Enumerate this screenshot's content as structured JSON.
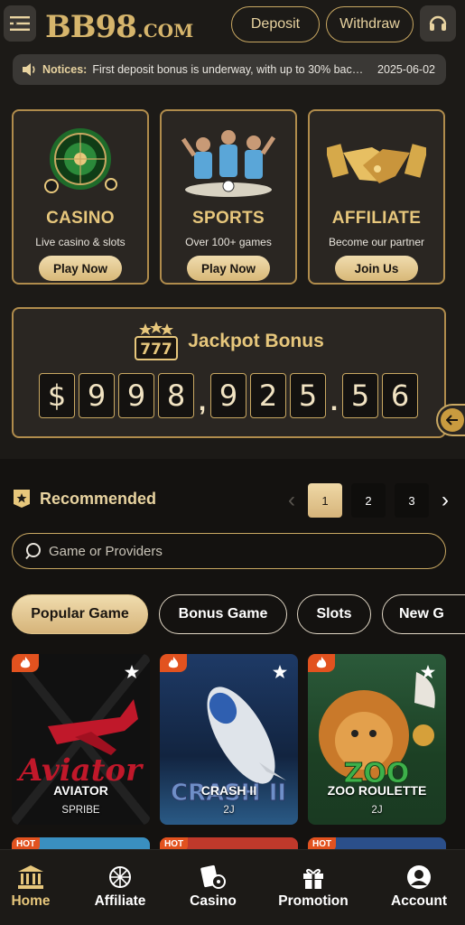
{
  "header": {
    "logo_main": "BB98",
    "logo_suffix": ".COM",
    "deposit_label": "Deposit",
    "withdraw_label": "Withdraw"
  },
  "notice": {
    "label": "Notices:",
    "message": "First deposit bonus is underway, with up to 30% back ...",
    "date": "2025-06-02"
  },
  "categories": [
    {
      "title": "CASINO",
      "subtitle": "Live casino & slots",
      "cta": "Play Now"
    },
    {
      "title": "SPORTS",
      "subtitle": "Over 100+ games",
      "cta": "Play Now"
    },
    {
      "title": "AFFILIATE",
      "subtitle": "Become our partner",
      "cta": "Join Us"
    }
  ],
  "jackpot": {
    "title": "Jackpot Bonus",
    "reel_text": "777",
    "currency": "$",
    "chars": [
      "9",
      "9",
      "8",
      ",",
      "9",
      "2",
      "5",
      ".",
      "5",
      "6"
    ]
  },
  "recommended": {
    "title": "Recommended",
    "pages": [
      "1",
      "2",
      "3"
    ],
    "active_page": "1"
  },
  "search": {
    "placeholder": "Game or Providers"
  },
  "tabs": [
    {
      "label": "Popular Game",
      "active": true
    },
    {
      "label": "Bonus Game",
      "active": false
    },
    {
      "label": "Slots",
      "active": false
    },
    {
      "label": "New G",
      "active": false
    }
  ],
  "games": [
    {
      "name": "AVIATOR",
      "provider": "SPRIBE",
      "art_text": "Aviator"
    },
    {
      "name": "CRASH II",
      "provider": "2J",
      "art_text": "CRASH II"
    },
    {
      "name": "ZOO ROULETTE",
      "provider": "2J",
      "art_text": "ZOO"
    }
  ],
  "next_row_badges": [
    "HOT",
    "HOT",
    "HOT"
  ],
  "bottom_nav": [
    {
      "label": "Home",
      "icon": "bank-icon",
      "active": true
    },
    {
      "label": "Affiliate",
      "icon": "network-icon",
      "active": false
    },
    {
      "label": "Casino",
      "icon": "cards-icon",
      "active": false
    },
    {
      "label": "Promotion",
      "icon": "gift-icon",
      "active": false
    },
    {
      "label": "Account",
      "icon": "user-icon",
      "active": false
    }
  ],
  "colors": {
    "gold": "#e7c77c",
    "background": "#141210",
    "panel": "#2a2622",
    "hot": "#e2521f"
  }
}
